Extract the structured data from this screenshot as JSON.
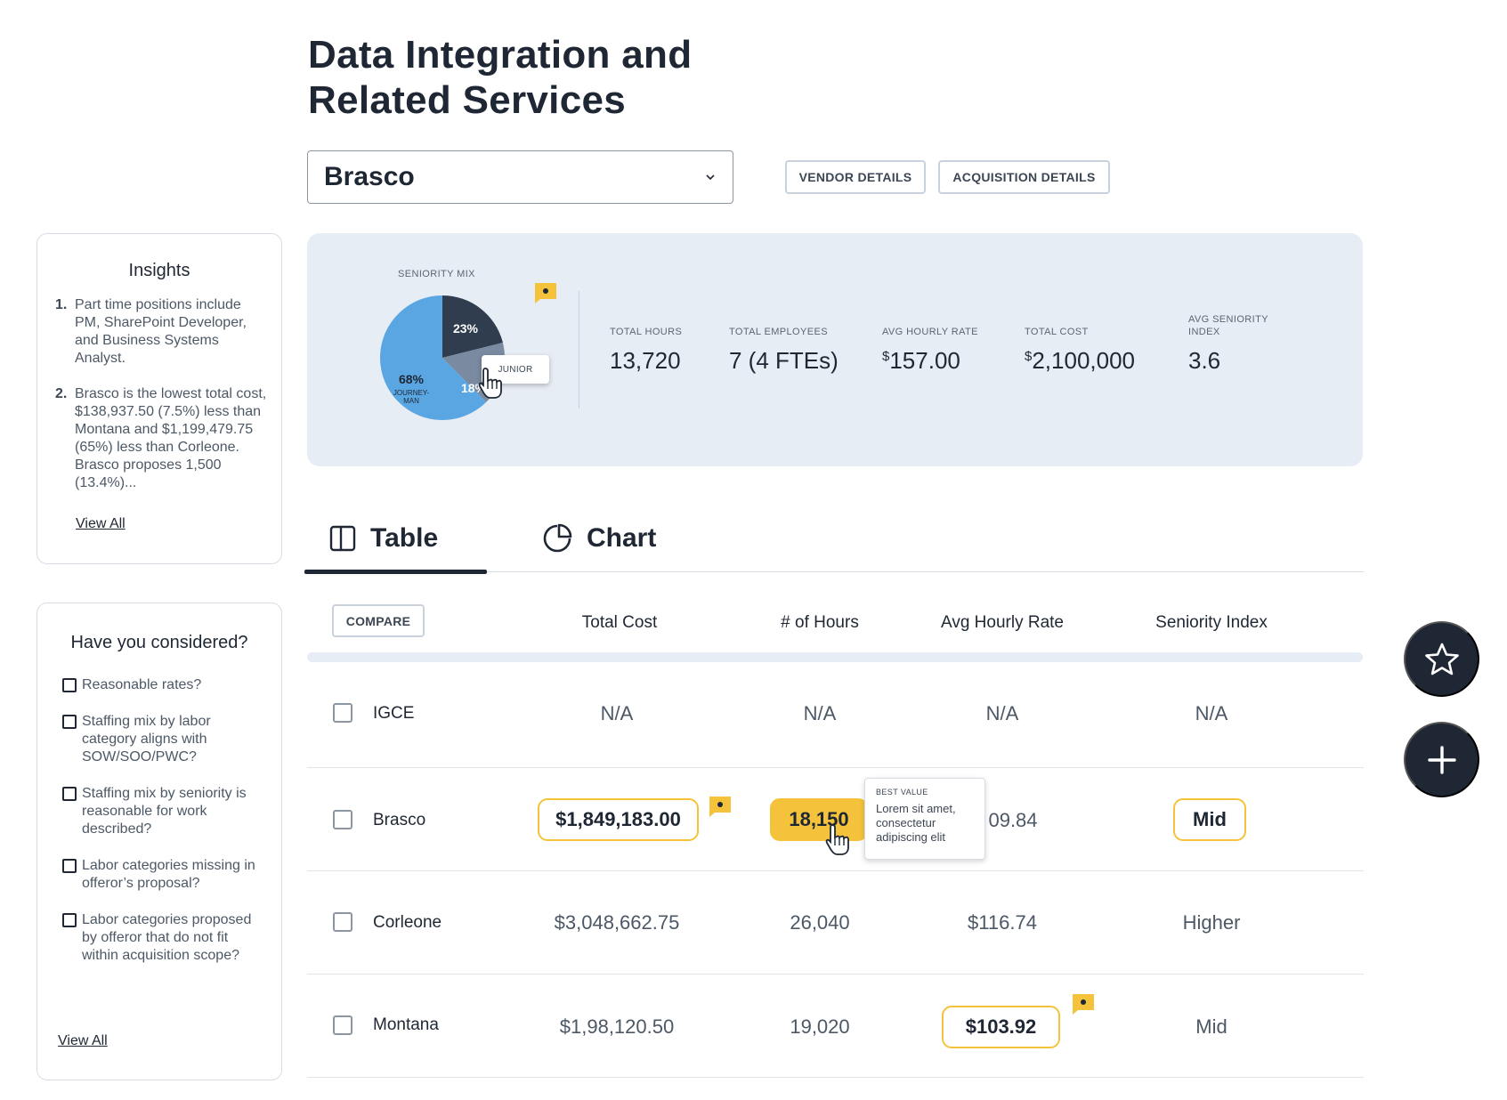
{
  "header": {
    "title": "Data Integration and Related Services"
  },
  "vendor_select": {
    "value": "Brasco",
    "icon": "chevron-down-icon"
  },
  "buttons": {
    "vendor_details": "VENDOR DETAILS",
    "acquisition_details": "ACQUISITION DETAILS",
    "compare": "COMPARE"
  },
  "insights": {
    "title": "Insights",
    "items": [
      {
        "num": "1.",
        "text": "Part time positions include PM, SharePoint Developer, and Business Systems Analyst."
      },
      {
        "num": "2.",
        "text": "Brasco is the lowest total cost, $138,937.50 (7.5%) less than Montana and $1,199,479.75 (65%) less than Corleone.  Brasco proposes 1,500 (13.4%)..."
      }
    ],
    "view_all": "View All"
  },
  "considered": {
    "title": "Have you considered?",
    "items": [
      "Reasonable rates?",
      "Staffing mix by labor category aligns with SOW/SOO/PWC?",
      "Staffing mix by seniority is reasonable for work described?",
      "Labor categories missing in offeror’s proposal?",
      "Labor categories proposed by offeror that do not fit within acquisition scope?"
    ],
    "view_all": "View All"
  },
  "summary": {
    "seniority_label": "SENIORITY MIX",
    "pie": {
      "slices": [
        {
          "label": "23%",
          "value": 23,
          "color": "#2f3d4f"
        },
        {
          "label": "18%",
          "value": 18,
          "color": "#7a8aa0"
        },
        {
          "label": "68%",
          "sublabel_1": "JOURNEY-",
          "sublabel_2": "MAN",
          "value": 68,
          "color": "#5aa6e3"
        }
      ],
      "tooltip": "JUNIOR"
    },
    "stats": [
      {
        "label_1": "TOTAL HOURS",
        "label_2": "",
        "prefix": "",
        "value": "13,720"
      },
      {
        "label_1": "TOTAL EMPLOYEES",
        "label_2": "",
        "prefix": "",
        "value": "7 (4 FTEs)"
      },
      {
        "label_1": "AVG HOURLY RATE",
        "label_2": "",
        "prefix": "$",
        "value": "157.00"
      },
      {
        "label_1": "TOTAL COST",
        "label_2": "",
        "prefix": "$",
        "value": "2,100,000"
      },
      {
        "label_1": "AVG SENIORITY",
        "label_2": "INDEX",
        "prefix": "",
        "value": "3.6"
      }
    ]
  },
  "tabs": [
    {
      "label": "Table",
      "icon": "columns-icon",
      "active": true
    },
    {
      "label": "Chart",
      "icon": "pie-chart-icon",
      "active": false
    }
  ],
  "table": {
    "columns": [
      "Total Cost",
      "# of Hours",
      "Avg Hourly Rate",
      "Seniority Index"
    ],
    "rows": [
      {
        "name": "IGCE",
        "cost": "N/A",
        "hours": "N/A",
        "rate": "N/A",
        "seniority": "N/A"
      },
      {
        "name": "Brasco",
        "cost": "$1,849,183.00",
        "hours": "18,150",
        "rate": "09.84",
        "seniority": "Mid"
      },
      {
        "name": "Corleone",
        "cost": "$3,048,662.75",
        "hours": "26,040",
        "rate": "$116.74",
        "seniority": "Higher"
      },
      {
        "name": "Montana",
        "cost": "$1,98,120.50",
        "hours": "19,020",
        "rate": "$103.92",
        "seniority": "Mid"
      }
    ],
    "best_value_tip": {
      "title": "BEST VALUE",
      "body": "Lorem sit amet, consectetur adipiscing elit"
    }
  },
  "colors": {
    "accent": "#f5c33b",
    "dark": "#1e2733",
    "panel": "#e7edf4"
  },
  "fabs": {
    "favorite_icon": "star-icon",
    "add_icon": "plus-icon"
  }
}
